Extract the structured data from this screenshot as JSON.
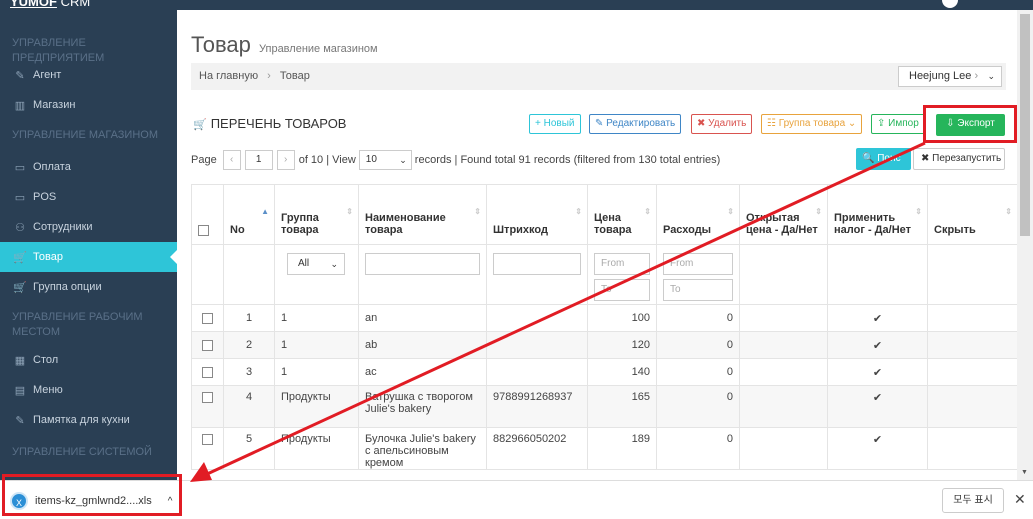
{
  "brand": {
    "logo": "YUMOF",
    "suffix": "CRM"
  },
  "sidebar": {
    "sections": [
      {
        "label": "УПРАВЛЕНИЕ ПРЕДПРИЯТИЕМ"
      },
      {
        "label": "УПРАВЛЕНИЕ МАГАЗИНОМ"
      },
      {
        "label": "УПРАВЛЕНИЕ РАБОЧИМ МЕСТОМ"
      },
      {
        "label": "УПРАВЛЕНИЕ СИСТЕМОЙ"
      }
    ],
    "items": [
      {
        "label": "Агент",
        "icon": "edit-icon",
        "glyph": "✎"
      },
      {
        "label": "Магазин",
        "icon": "store-icon",
        "glyph": "▥"
      },
      {
        "label": "Оплата",
        "icon": "card-icon",
        "glyph": "▭"
      },
      {
        "label": "POS",
        "icon": "pos-icon",
        "glyph": "▭"
      },
      {
        "label": "Сотрудники",
        "icon": "users-icon",
        "glyph": "⚇"
      },
      {
        "label": "Товар",
        "icon": "cart-icon",
        "glyph": "🛒"
      },
      {
        "label": "Группа опции",
        "icon": "cart-icon",
        "glyph": "🛒"
      },
      {
        "label": "Стол",
        "icon": "grid-icon",
        "glyph": "▦"
      },
      {
        "label": "Меню",
        "icon": "book-icon",
        "glyph": "▤"
      },
      {
        "label": "Памятка для кухни",
        "icon": "note-icon",
        "glyph": "✎"
      }
    ]
  },
  "page": {
    "title": "Товар",
    "subtitle": "Управление магазином"
  },
  "breadcrumb": {
    "home": "На главную",
    "sep": "›",
    "current": "Товар"
  },
  "user": {
    "name": "Heejung Lee",
    "sep": "›"
  },
  "list": {
    "title": "ПЕРЕЧЕНЬ ТОВАРОВ"
  },
  "toolbar": {
    "new": "+ Новый",
    "edit": "✎ Редактировать",
    "delete": "✖ Удалить",
    "group": "☷ Группа товара ⌄",
    "import": "⇪ Импор",
    "export": "⇩ Экспорт"
  },
  "pager": {
    "page_label": "Page",
    "prev": "‹",
    "page": "1",
    "next": "›",
    "of_text": "of 10 | View",
    "view": "10",
    "records_text": "records | Found total 91 records (filtered from 130 total entries)",
    "search": "🔍 Поис",
    "reset": "✖ Перезапустить"
  },
  "table": {
    "headers": [
      "No",
      "Группа товара",
      "Наименование товара",
      "Штрихкод",
      "Цена товара",
      "Расходы",
      "Открытая цена - Да/Нет",
      "Применить налог - Да/Нет",
      "Скрыть"
    ],
    "filter": {
      "group": "All",
      "from": "From",
      "to": "To"
    },
    "check_glyph": "✔",
    "rows": [
      {
        "no": "1",
        "group": "1",
        "name": "an",
        "barcode": "",
        "price": "100",
        "cost": "0",
        "open": "",
        "tax": "✔",
        "hide": ""
      },
      {
        "no": "2",
        "group": "1",
        "name": "ab",
        "barcode": "",
        "price": "120",
        "cost": "0",
        "open": "",
        "tax": "✔",
        "hide": ""
      },
      {
        "no": "3",
        "group": "1",
        "name": "ac",
        "barcode": "",
        "price": "140",
        "cost": "0",
        "open": "",
        "tax": "✔",
        "hide": ""
      },
      {
        "no": "4",
        "group": "Продукты",
        "name": "Ватрушка с творогом Julie's bakery",
        "barcode": "9788991268937",
        "price": "165",
        "cost": "0",
        "open": "",
        "tax": "✔",
        "hide": ""
      },
      {
        "no": "5",
        "group": "Продукты",
        "name": "Булочка Julie's bakery с апельсиновым кремом",
        "barcode": "882966050202",
        "price": "189",
        "cost": "0",
        "open": "",
        "tax": "✔",
        "hide": ""
      }
    ]
  },
  "download": {
    "file": "items-kz_gmlwnd2....xls",
    "chev": "^",
    "show_all": "모두 표시",
    "close": "✕"
  },
  "colors": {
    "sidebar": "#2a3f54",
    "active": "#2ec5d8",
    "export": "#26b55b",
    "highlight": "#e11c24"
  }
}
